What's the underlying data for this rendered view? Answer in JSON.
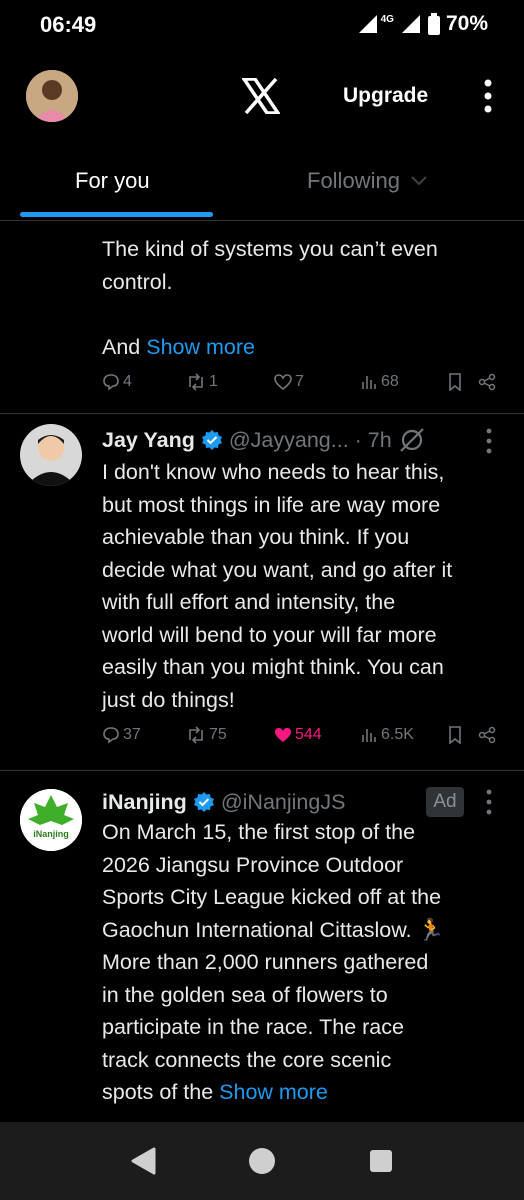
{
  "status_bar": {
    "time": "06:49",
    "network": "4G",
    "battery": "70%"
  },
  "header": {
    "upgrade_label": "Upgrade"
  },
  "tabs": [
    {
      "label": "For you",
      "active": true
    },
    {
      "label": "Following",
      "active": false
    }
  ],
  "tweets": [
    {
      "text_lines": [
        "The kind of systems you can’t even",
        "control.",
        "",
        "And "
      ],
      "show_more": "Show more",
      "stats": {
        "replies": "4",
        "reposts": "1",
        "likes": "7",
        "views": "68"
      }
    },
    {
      "name": "Jay Yang",
      "handle": "@Jayyang...",
      "time": "· 7h",
      "text_lines": [
        "I don't know who needs to hear this,",
        "but most things in life are way more",
        "achievable than you think. If you",
        "decide what you want, and go after it",
        "with full effort and intensity, the",
        "world will bend to your will far more",
        "easily than you might think. You can",
        "just do things!"
      ],
      "stats": {
        "replies": "37",
        "reposts": "75",
        "likes": "544",
        "views": "6.5K"
      },
      "liked": true
    },
    {
      "name": "iNanjing",
      "handle": "@iNanjingJS",
      "badge": "Ad",
      "avatar_text": "iNanjing",
      "text_lines": [
        "On March 15, the first stop of the",
        "2026 Jiangsu Province Outdoor",
        "Sports City League kicked off at the",
        "Gaochun International Cittaslow. 🏃",
        "More than 2,000 runners gathered",
        "in the golden sea of flowers to",
        "participate in the race. The race",
        "track connects the core scenic",
        "spots of the "
      ],
      "show_more": "Show more"
    }
  ],
  "colors": {
    "accent": "#1d9bf0",
    "like": "#f91880",
    "muted": "#71767b",
    "text": "#e7e9ea"
  },
  "icons": [
    "reply-icon",
    "repost-icon",
    "like-icon",
    "views-icon",
    "bookmark-icon",
    "share-icon",
    "verified-icon",
    "grok-icon",
    "more-icon"
  ]
}
